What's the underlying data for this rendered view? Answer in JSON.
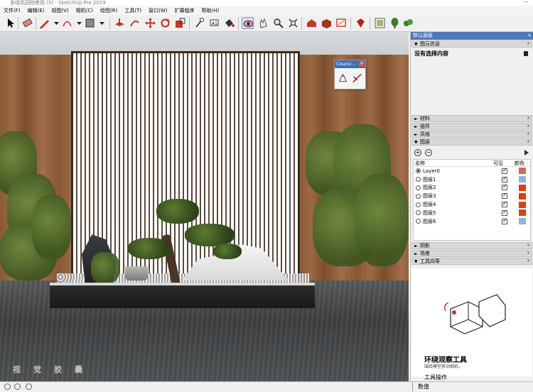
{
  "window": {
    "title": "多绿花园物景观 (5) - SketchUp Pro 2019",
    "minimize": "—"
  },
  "menu": [
    "文件(F)",
    "编辑(E)",
    "视图(V)",
    "相机(C)",
    "绘图(R)",
    "工具(T)",
    "窗口(W)",
    "扩展程序",
    "帮助(H)"
  ],
  "toolbar": {
    "icons": [
      "select-icon",
      "eraser-icon",
      "pencil-icon",
      "arc-icon",
      "rectangle-icon",
      "push-pull-icon",
      "offset-icon",
      "move-icon",
      "rotate-icon",
      "scale-icon",
      "tape-measure-icon",
      "text-icon",
      "paint-bucket-icon",
      "orbit-icon",
      "pan-icon",
      "zoom-icon",
      "zoom-extents-icon",
      "warehouse-icon",
      "extension-warehouse-icon",
      "layout-icon",
      "ruby-icon",
      "styles-icon",
      "components-icon",
      "scene-icon"
    ],
    "selected": "orbit-icon"
  },
  "cleanup_toolbar": {
    "title": "CleanU...",
    "close": "×"
  },
  "viewport": {
    "watermark": [
      "视",
      "觉",
      "胶",
      "囊"
    ]
  },
  "panel": {
    "title": "默认面板",
    "close": "×",
    "sections": {
      "entity_info": "图元信息",
      "materials": "材料",
      "components": "组件",
      "styles": "风格",
      "layers": "图层",
      "shadows": "阴影",
      "scenes": "场景",
      "instructor": "工具向导"
    },
    "entity_info_text": "没有选择内容",
    "layers": {
      "headers": [
        "名称",
        "可见",
        "颜色"
      ],
      "rows": [
        {
          "name": "Layer0",
          "active": true,
          "color": "#c76b5a"
        },
        {
          "name": "图层1",
          "active": false,
          "color": "#8fb4e0"
        },
        {
          "name": "图层2",
          "active": false,
          "color": "#d6411a"
        },
        {
          "name": "图层3",
          "active": false,
          "color": "#d6411a"
        },
        {
          "name": "图层4",
          "active": false,
          "color": "#d6411a"
        },
        {
          "name": "图层5",
          "active": false,
          "color": "#d6411a"
        },
        {
          "name": "图层6",
          "active": false,
          "color": "#8fb4e0"
        }
      ]
    },
    "instructor": {
      "title": "环绕观察工具",
      "subtitle": "围绕模型移动相机。",
      "ops": "工具操作"
    }
  },
  "status": {
    "measure_label": "数值"
  }
}
